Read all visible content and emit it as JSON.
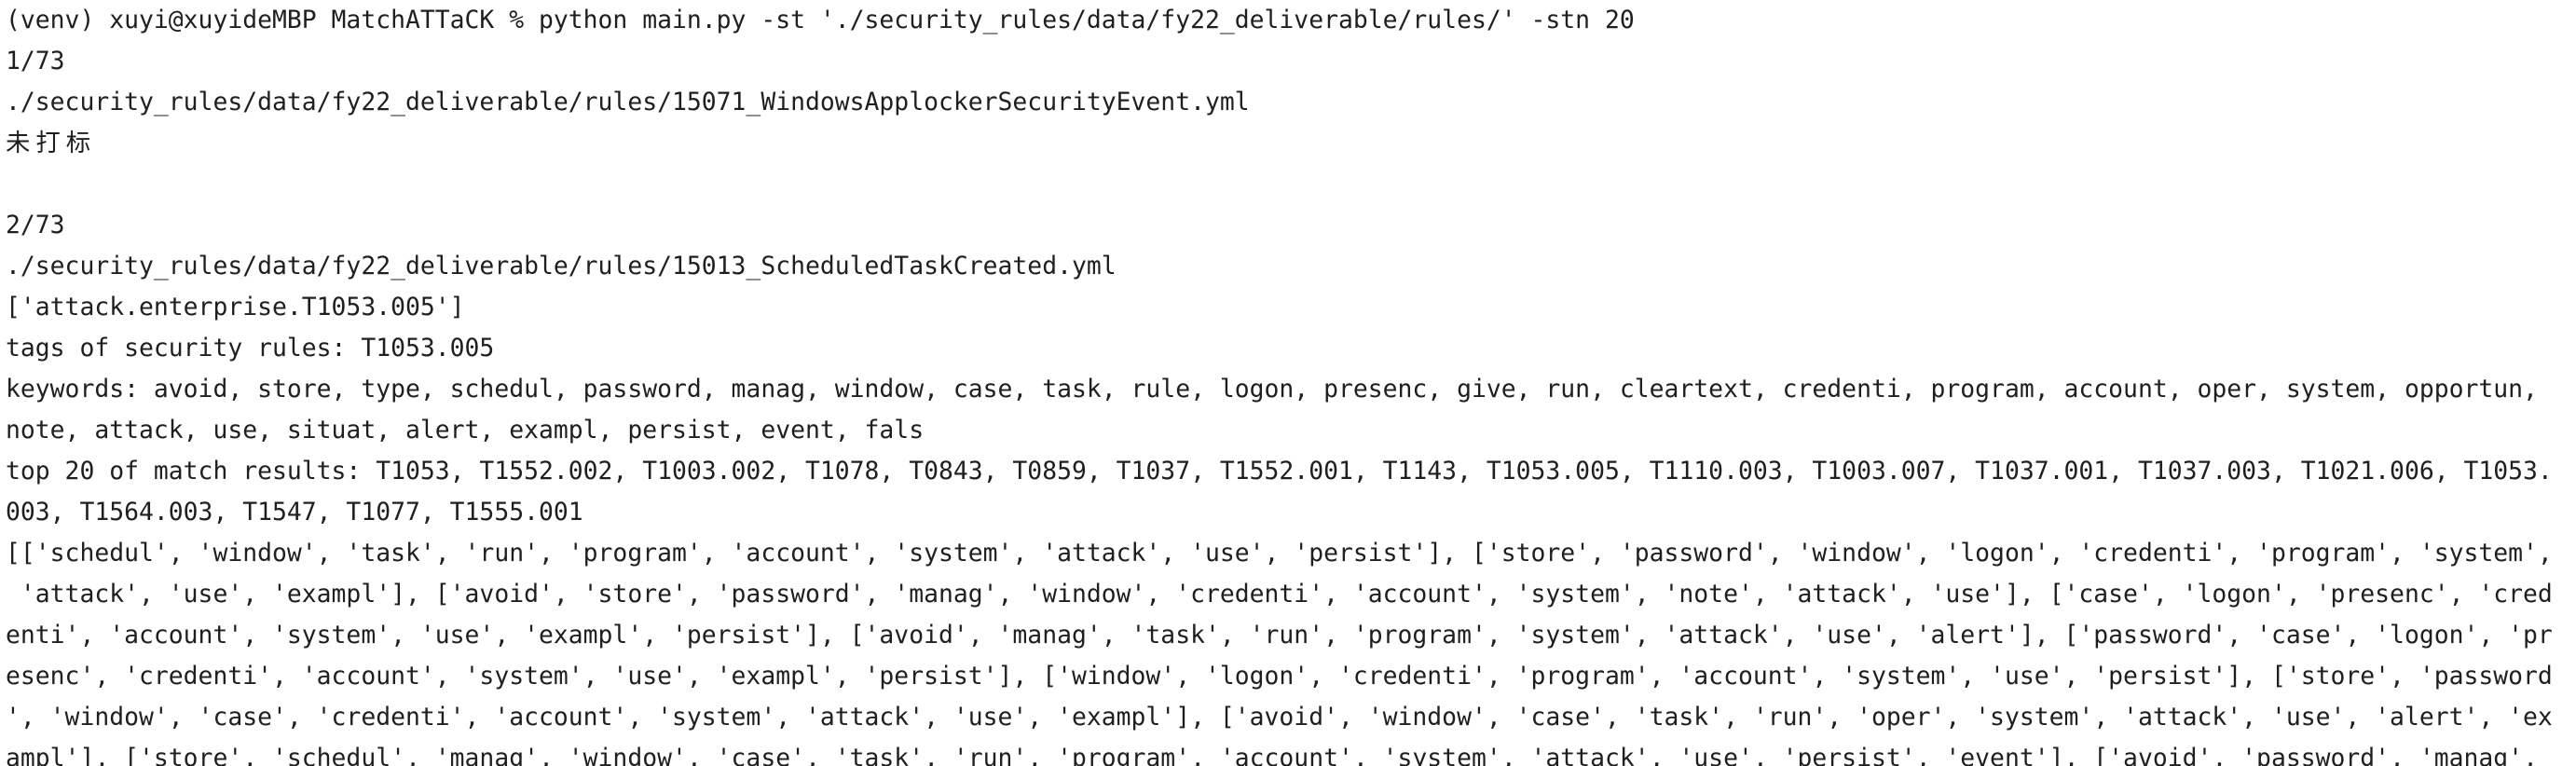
{
  "terminal": {
    "prompt": "(venv) xuyi@xuyideMBP MatchATTaCK % python main.py -st './security_rules/data/fy22_deliverable/rules/' -stn 20",
    "rule1": {
      "counter": "1/73",
      "path": "./security_rules/data/fy22_deliverable/rules/15071_WindowsApplockerSecurityEvent.yml",
      "status": "未打标"
    },
    "rule2": {
      "counter": "2/73",
      "path": "./security_rules/data/fy22_deliverable/rules/15013_ScheduledTaskCreated.yml",
      "tags_list": "['attack.enterprise.T1053.005']",
      "tags_line": "tags of security rules: T1053.005",
      "keywords_1": "keywords: avoid, store, type, schedul, password, manag, window, case, task, rule, logon, presenc, give, run, cleartext, credenti, program, account, oper, system, opportun,",
      "keywords_2": "note, attack, use, situat, alert, exampl, persist, event, fals",
      "top_1": "top 20 of match results: T1053, T1552.002, T1003.002, T1078, T0843, T0859, T1037, T1552.001, T1143, T1053.005, T1110.003, T1003.007, T1037.001, T1037.003, T1021.006, T1053.",
      "top_2": "003, T1564.003, T1547, T1077, T1555.001",
      "lists_1": "[['schedul', 'window', 'task', 'run', 'program', 'account', 'system', 'attack', 'use', 'persist'], ['store', 'password', 'window', 'logon', 'credenti', 'program', 'system',",
      "lists_2": " 'attack', 'use', 'exampl'], ['avoid', 'store', 'password', 'manag', 'window', 'credenti', 'account', 'system', 'note', 'attack', 'use'], ['case', 'logon', 'presenc', 'cred",
      "lists_3": "enti', 'account', 'system', 'use', 'exampl', 'persist'], ['avoid', 'manag', 'task', 'run', 'program', 'system', 'attack', 'use', 'alert'], ['password', 'case', 'logon', 'pr",
      "lists_4": "esenc', 'credenti', 'account', 'system', 'use', 'exampl', 'persist'], ['window', 'logon', 'credenti', 'program', 'account', 'system', 'use', 'persist'], ['store', 'password",
      "lists_5": "', 'window', 'case', 'credenti', 'account', 'system', 'attack', 'use', 'exampl'], ['avoid', 'window', 'case', 'task', 'run', 'oper', 'system', 'attack', 'use', 'alert', 'ex",
      "lists_6": "ampl'], ['store', 'schedul', 'manag', 'window', 'case', 'task', 'run', 'program', 'account', 'system', 'attack', 'use', 'persist', 'event'], ['avoid', 'password', 'manag',"
    }
  }
}
